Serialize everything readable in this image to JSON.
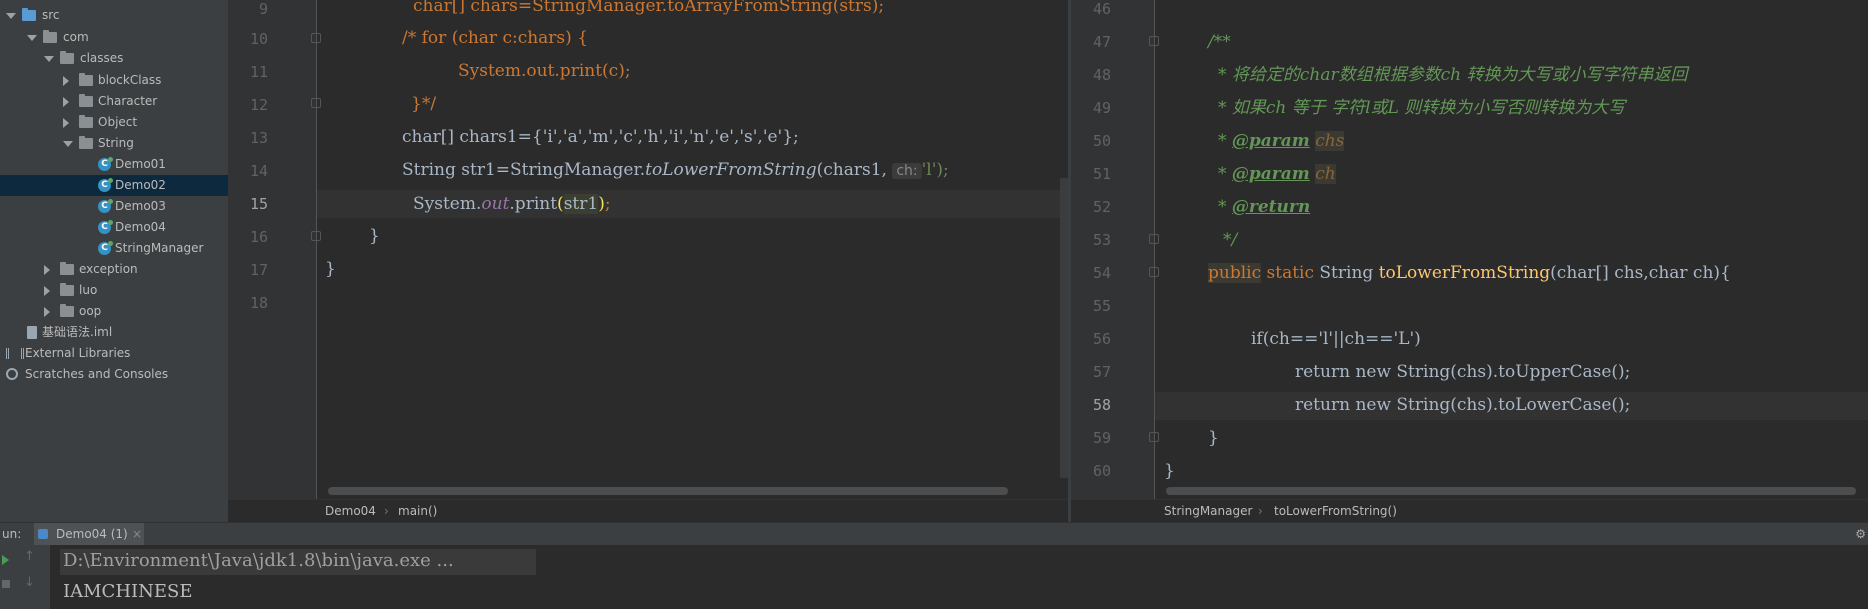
{
  "project_tree": {
    "items": [
      {
        "label": "src"
      },
      {
        "label": "com"
      },
      {
        "label": "classes"
      },
      {
        "label": "blockClass"
      },
      {
        "label": "Character"
      },
      {
        "label": "Object"
      },
      {
        "label": "String"
      },
      {
        "label": "Demo01"
      },
      {
        "label": "Demo02",
        "selected": true
      },
      {
        "label": "Demo03"
      },
      {
        "label": "Demo04"
      },
      {
        "label": "StringManager"
      },
      {
        "label": "exception"
      },
      {
        "label": "luo"
      },
      {
        "label": "oop"
      },
      {
        "label": "基础语法.iml"
      },
      {
        "label": "External Libraries"
      },
      {
        "label": "Scratches and Consoles"
      }
    ]
  },
  "left_editor": {
    "line_numbers": [
      "9",
      "10",
      "11",
      "12",
      "13",
      "14",
      "15",
      "16",
      "17",
      "18"
    ],
    "current_line": "15",
    "lines": {
      "l9": "char[] chars=StringManager.toArrayFromString(strs);",
      "l10": "/* for (char c:chars) {",
      "l11": "System.out.print(c);",
      "l12": "}*/",
      "l13": "char[] chars1={'i','a','m','c','h','i','n','e','s','e'};",
      "l14a": "String str1=StringManager.",
      "l14b": "toLowerFromString",
      "l14c": "(chars1,",
      "l14hint": "ch:",
      "l14d": "'l');",
      "l15a": "System.",
      "l15b": "out",
      "l15c": ".print",
      "l15d": "(",
      "l15e": "str1",
      "l15f": ")",
      "l15g": ";",
      "l16": "}",
      "l17": "}"
    },
    "breadcrumb": [
      "Demo04",
      "main()"
    ]
  },
  "right_editor": {
    "line_numbers": [
      "46",
      "47",
      "48",
      "49",
      "50",
      "51",
      "52",
      "53",
      "54",
      "55",
      "56",
      "57",
      "58",
      "59",
      "60"
    ],
    "current_line": "58",
    "lines": {
      "l47": "/**",
      "l48": "* 将给定的char数组根据参数ch 转换为大写或小写字符串返回",
      "l49": "* 如果ch 等于 字符l或L 则转换为小写否则转换为大写",
      "l50tag": "@param",
      "l50par": "chs",
      "l51tag": "@param",
      "l51par": "ch",
      "l52tag": "@return",
      "l53": "*/",
      "l54kw": "public",
      "l54kw2": "static",
      "l54type": "String",
      "l54fn": "toLowerFromString",
      "l54args": "(char[] chs,char ch){",
      "l56": "if(ch=='l'||ch=='L')",
      "l57": "return new String(chs).toUpperCase();",
      "l58": "return new String(chs).toLowerCase();",
      "l59": "}",
      "l60": "}"
    },
    "breadcrumb": [
      "StringManager",
      "toLowerFromString()"
    ]
  },
  "run_panel": {
    "label": "un:",
    "tab": "Demo04 (1)",
    "console_lines": [
      "D:\\Environment\\Java\\jdk1.8\\bin\\java.exe ...",
      "IAMCHINESE"
    ]
  }
}
